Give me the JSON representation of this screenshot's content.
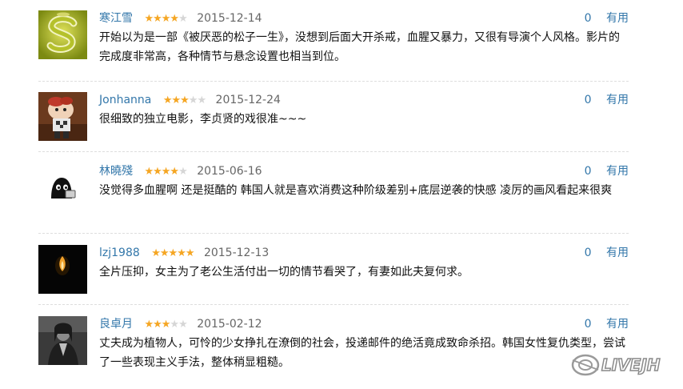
{
  "reviews": [
    {
      "user": "寒江雪",
      "rating": 4,
      "date": "2015-12-14",
      "votes": "0",
      "useful_label": "有用",
      "text": "开始以为是一部《被厌恶的松子一生》，没想到后面大开杀戒，血腥又暴力，又很有导演个人风格。影片的完成度非常高，各种情节与悬念设置也相当到位。",
      "avatar": "shrek-avatar"
    },
    {
      "user": "Jonhanna",
      "rating": 3,
      "date": "2015-12-24",
      "votes": "0",
      "useful_label": "有用",
      "text": "很细致的独立电影，李贞贤的戏很准~~~",
      "avatar": "toy-figure-avatar"
    },
    {
      "user": "林曉殘",
      "rating": 4,
      "date": "2015-06-16",
      "votes": "0",
      "useful_label": "有用",
      "text": "没觉得多血腥啊 还是挺酷的 韩国人就是喜欢消费这种阶级差别+底层逆袭的快感 凌厉的画风看起来很爽",
      "avatar": "black-blob-avatar"
    },
    {
      "user": "lzj1988",
      "rating": 5,
      "date": "2015-12-13",
      "votes": "0",
      "useful_label": "有用",
      "text": "全片压抑，女主为了老公生活付出一切的情节看哭了，有妻如此夫复何求。",
      "avatar": "candle-avatar"
    },
    {
      "user": "良卓月",
      "rating": 3,
      "date": "2015-02-12",
      "votes": "0",
      "useful_label": "有用",
      "text": "丈夫成为植物人，可怜的少女挣扎在潦倒的社会，投递邮件的绝活竟成致命杀招。韩国女性复仇类型，尝试了一些表现主义手法，整体稍显粗糙。",
      "avatar": "bw-portrait-avatar"
    }
  ],
  "rating_max": 5,
  "watermark": {
    "text": "LIVEJH"
  },
  "colors": {
    "link": "#3377aa",
    "star_on": "#f5a623",
    "star_off": "#d6d6d6",
    "date": "#666666",
    "divider": "#dddddd"
  }
}
